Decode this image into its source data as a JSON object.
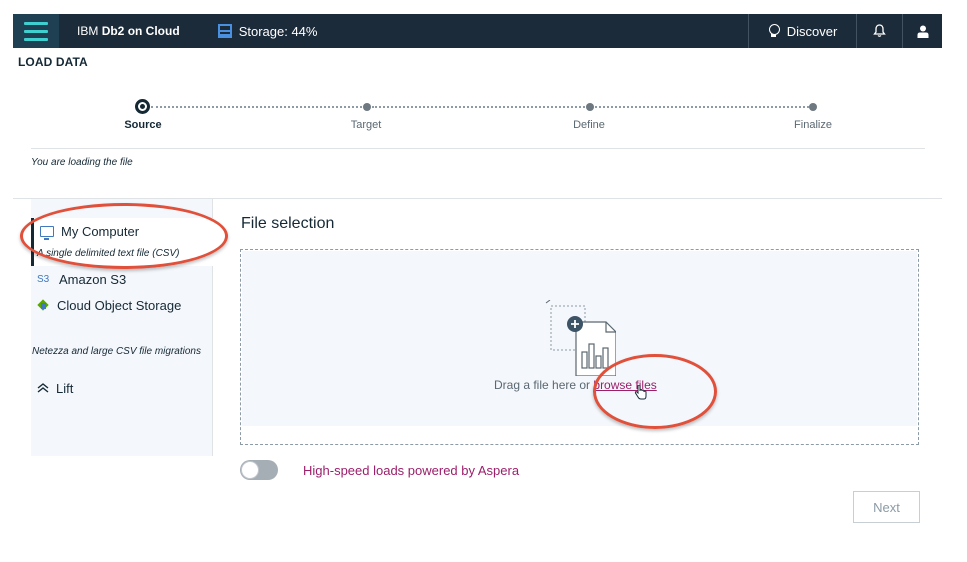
{
  "header": {
    "brand_prefix": "IBM",
    "brand_name": "Db2 on Cloud",
    "storage_label": "Storage: 44%",
    "discover_label": "Discover",
    "icons": {
      "menu": "hamburger-menu-icon",
      "storage": "storage-icon",
      "discover": "lightbulb-icon",
      "notifications": "bell-icon",
      "user": "user-icon"
    },
    "colors": {
      "bar": "#1c2b3a",
      "accent": "#3ecfd0"
    }
  },
  "page_title": "LOAD DATA",
  "stepper": {
    "steps": [
      {
        "label": "Source",
        "state": "current"
      },
      {
        "label": "Target",
        "state": "upcoming"
      },
      {
        "label": "Define",
        "state": "upcoming"
      },
      {
        "label": "Finalize",
        "state": "upcoming"
      }
    ]
  },
  "loading_note": "You are loading the file",
  "sources": {
    "my_computer": {
      "label": "My Computer",
      "subtitle": "A single delimited text file (CSV)",
      "icon": "monitor-icon",
      "selected": true
    },
    "amazon_s3": {
      "label": "Amazon S3",
      "icon_text": "S3"
    },
    "cloud_object_storage": {
      "label": "Cloud Object Storage",
      "icon": "cube-icon"
    },
    "netezza_note": "Netezza and large CSV file migrations",
    "lift": {
      "label": "Lift",
      "icon": "chevron-up-icon"
    }
  },
  "file_selection": {
    "title": "File selection",
    "drag_text": "Drag a file here or ",
    "browse_link": "browse files"
  },
  "aspera": {
    "label": "High-speed loads powered by Aspera",
    "enabled": false
  },
  "next_button": "Next",
  "link_color": "#9b1f6b",
  "annotation_color": "#e0503a"
}
